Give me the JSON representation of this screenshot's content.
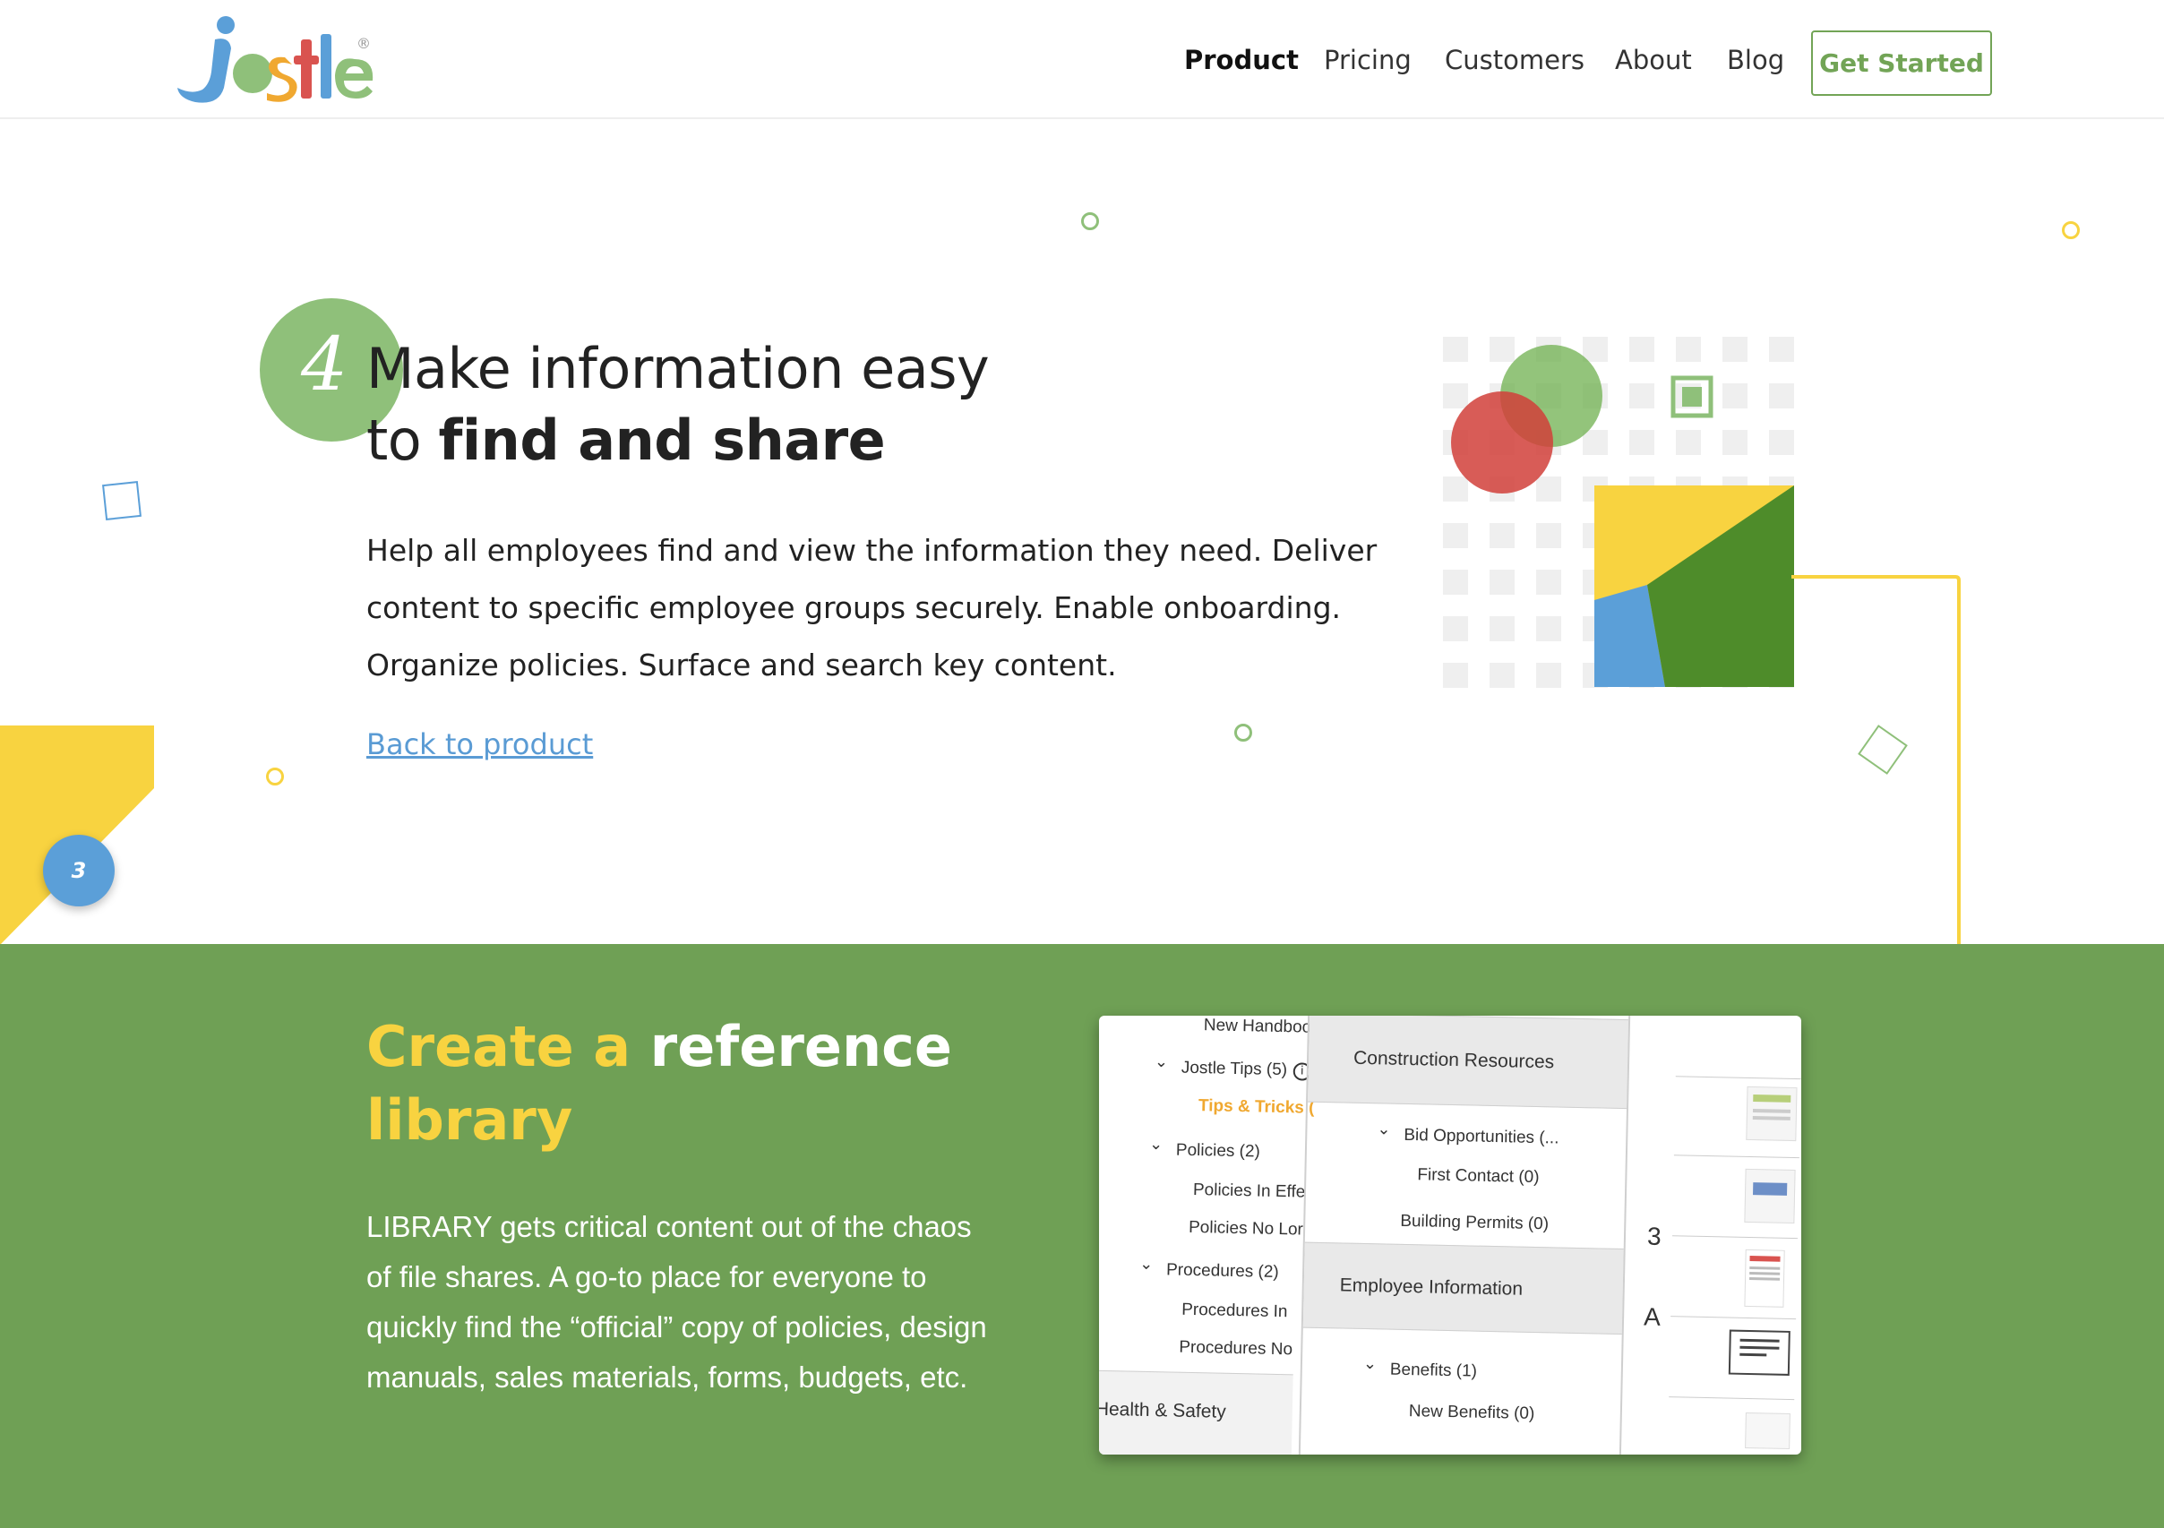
{
  "brand": {
    "logo_text": "jostle",
    "registered": "®",
    "green": "#72a456",
    "yellow": "#f8d340",
    "blue": "#5b9fd8",
    "red": "#d9534f"
  },
  "nav": {
    "items": [
      {
        "label": "Product",
        "active": true
      },
      {
        "label": "Pricing"
      },
      {
        "label": "Customers"
      },
      {
        "label": "About"
      },
      {
        "label": "Blog"
      }
    ],
    "cta": "Get Started"
  },
  "hero": {
    "step": "4",
    "title_line1": "Make information easy",
    "title_line2_prefix": "to ",
    "title_line2_bold": "find and share",
    "body": "Help all employees find and view the information they need. Deliver content to specific employee groups securely. Enable onboarding. Organize policies. Surface and search key content.",
    "back_link": "Back to product",
    "prev_step_badge": "3"
  },
  "library": {
    "title_yellow": "Create a ",
    "title_white": "reference",
    "title_line2": "library",
    "body": "LIBRARY gets critical content out of the chaos of file shares. A go-to place for everyone to quickly find the “official” copy of policies, design manuals, sales materials, forms, budgets, etc."
  },
  "screenshot": {
    "left_col": [
      "New Handboo",
      "Jostle Tips (5)",
      "Tips & Tricks (",
      "Policies (2)",
      "Policies In Effe",
      "Policies No Lor",
      "Procedures (2)",
      "Procedures In",
      "Procedures No",
      "Health & Safety"
    ],
    "mid_col": [
      "Construction Resources",
      "Bid Opportunities (...",
      "First Contact (0)",
      "Building Permits (0)",
      "Employee Information",
      "Benefits (1)",
      "New Benefits (0)"
    ],
    "right_letters": [
      "3",
      "A"
    ]
  }
}
